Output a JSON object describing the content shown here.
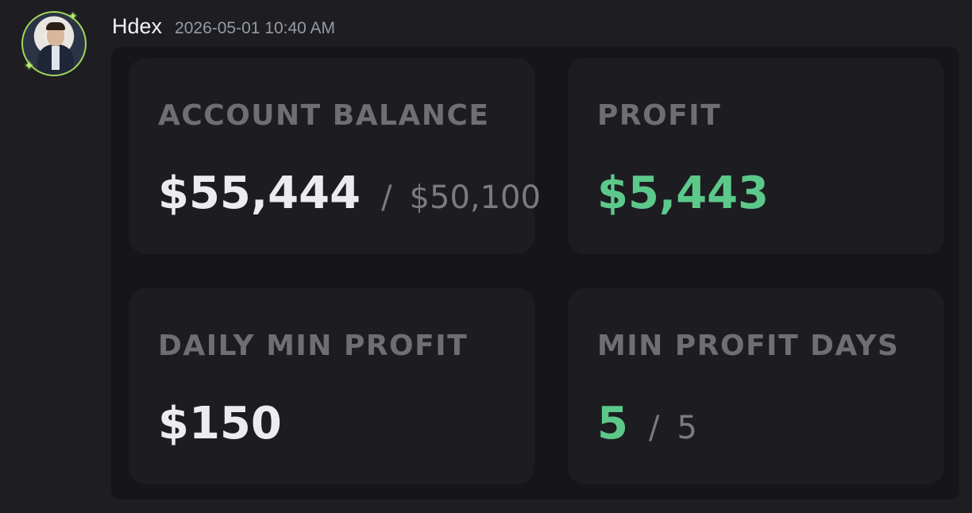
{
  "message": {
    "username": "Hdex",
    "timestamp": "2026-05-01 10:40 AM"
  },
  "stats": {
    "account_balance": {
      "label": "ACCOUNT BALANCE",
      "value": "$55,444",
      "separator": "/",
      "target": "$50,100"
    },
    "profit": {
      "label": "PROFIT",
      "value": "$5,443"
    },
    "daily_min_profit": {
      "label": "DAILY MIN PROFIT",
      "value": "$150"
    },
    "min_profit_days": {
      "label": "MIN PROFIT DAYS",
      "value": "5",
      "separator": "/",
      "target": "5"
    }
  },
  "colors": {
    "positive": "#5cc98a",
    "avatar_ring": "#a3d65c"
  }
}
